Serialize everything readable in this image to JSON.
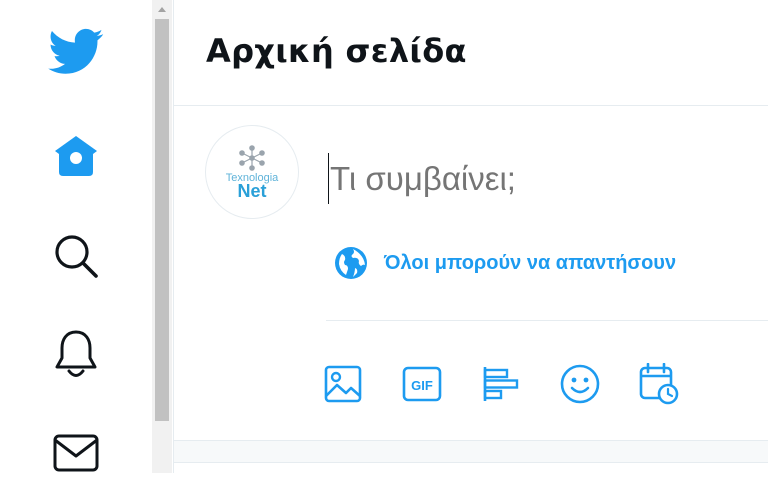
{
  "header": {
    "title": "Αρχική σελίδα"
  },
  "compose": {
    "placeholder": "Τι συμβαίνει;",
    "reply_setting": "Όλοι μπορούν να απαντήσουν",
    "avatar": {
      "brand": "Texnologia",
      "brand_bold": "Net"
    }
  },
  "sidebar": {
    "items": [
      {
        "name": "twitter-logo-icon"
      },
      {
        "name": "home-icon",
        "active": true
      },
      {
        "name": "search-icon"
      },
      {
        "name": "notifications-bell-icon"
      },
      {
        "name": "messages-mail-icon"
      }
    ]
  },
  "toolbar": {
    "items": [
      "media-image-icon",
      "gif-icon",
      "poll-icon",
      "emoji-icon",
      "schedule-icon"
    ],
    "gif_label": "GIF"
  },
  "colors": {
    "accent": "#1d9bf0",
    "text": "#0f1419",
    "muted": "#5b7083",
    "border": "#e6ecf0"
  }
}
